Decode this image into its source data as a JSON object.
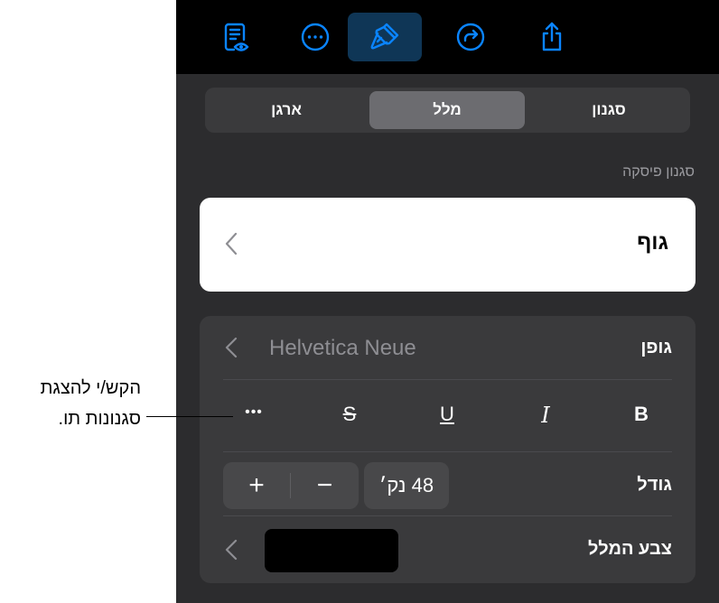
{
  "toolbar": {
    "icons": [
      "reader-view-icon",
      "more-icon",
      "format-brush-icon",
      "redo-icon",
      "share-icon"
    ],
    "active": "format-brush-icon",
    "accent_color": "#0a84ff"
  },
  "tabs": {
    "items": [
      {
        "label": "סגנון"
      },
      {
        "label": "מלל"
      },
      {
        "label": "ארגן"
      }
    ],
    "selected": "מלל"
  },
  "paragraph_style": {
    "section_label": "סגנון פיסקה",
    "value": "גוף"
  },
  "font": {
    "label": "גופן",
    "value": "Helvetica Neue"
  },
  "formatting": {
    "bold": "B",
    "italic": "I",
    "underline": "U",
    "strikethrough": "S",
    "more": "•••"
  },
  "size": {
    "label": "גודל",
    "value": "48 נק׳",
    "minus": "−",
    "plus": "+"
  },
  "text_color": {
    "label": "צבע המלל",
    "swatch_color": "#000000"
  },
  "callout": {
    "line1": "הקש/י להצגת",
    "line2": "סגנונות תו."
  }
}
